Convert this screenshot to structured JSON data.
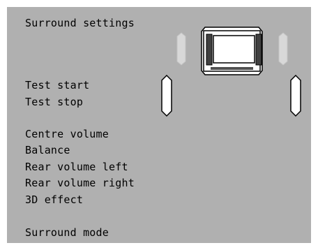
{
  "menu": {
    "title": "Surround settings",
    "items": [
      {
        "id": "test-start",
        "label": "Test start"
      },
      {
        "id": "test-stop",
        "label": "Test stop"
      },
      {
        "id": "centre-volume",
        "label": "Centre volume"
      },
      {
        "id": "balance",
        "label": "Balance"
      },
      {
        "id": "rear-volume-left",
        "label": "Rear volume left"
      },
      {
        "id": "rear-volume-right",
        "label": "Rear volume right"
      },
      {
        "id": "3d-effect",
        "label": "3D effect"
      },
      {
        "id": "surround-mode",
        "label": "Surround mode"
      }
    ]
  },
  "diagram": {
    "icons": [
      "tv-icon",
      "front-left-speaker-icon",
      "front-right-speaker-icon",
      "rear-left-speaker-icon",
      "rear-right-speaker-icon"
    ]
  },
  "colors": {
    "background": "#b0b0b0",
    "inactive_speaker": "#d8d8d8",
    "active_fill": "#ffffff",
    "text": "#000000"
  }
}
